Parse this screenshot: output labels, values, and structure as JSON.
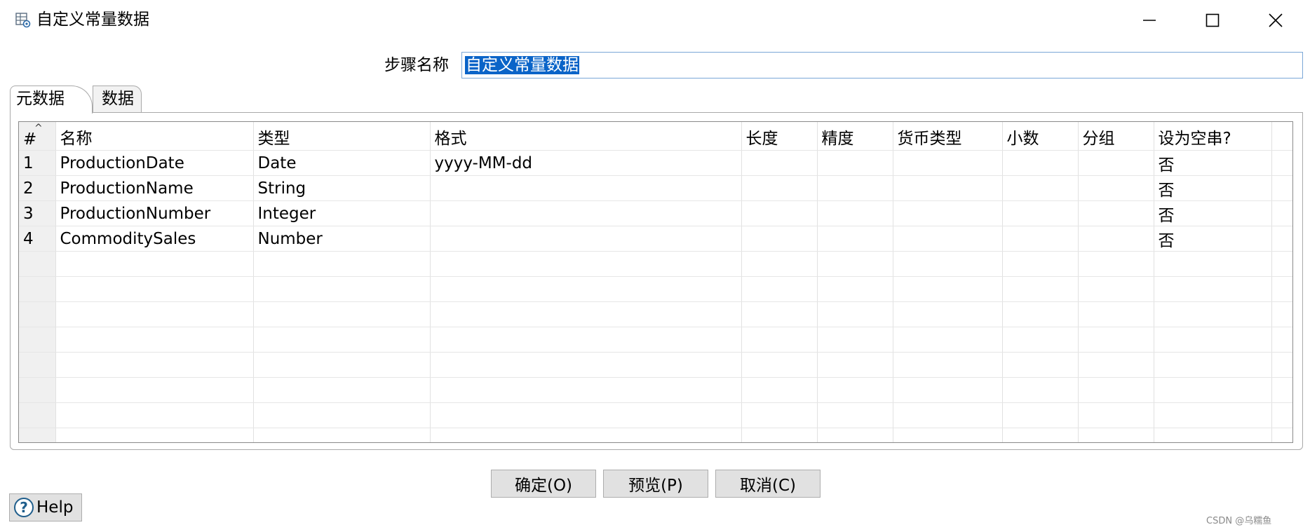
{
  "window": {
    "title": "自定义常量数据",
    "icon": "table-gear-icon",
    "controls": [
      "minimize-icon",
      "maximize-icon",
      "close-icon"
    ]
  },
  "step": {
    "label": "步骤名称",
    "value": "自定义常量数据"
  },
  "tabs": [
    {
      "label": "元数据",
      "active": true
    },
    {
      "label": "数据",
      "active": false
    }
  ],
  "grid": {
    "columns": [
      "#",
      "名称",
      "类型",
      "格式",
      "长度",
      "精度",
      "货币类型",
      "小数",
      "分组",
      "设为空串?"
    ],
    "rows": [
      [
        "1",
        "ProductionDate",
        "Date",
        "yyyy-MM-dd",
        "",
        "",
        "",
        "",
        "",
        "否"
      ],
      [
        "2",
        "ProductionName",
        "String",
        "",
        "",
        "",
        "",
        "",
        "",
        "否"
      ],
      [
        "3",
        "ProductionNumber",
        "Integer",
        "",
        "",
        "",
        "",
        "",
        "",
        "否"
      ],
      [
        "4",
        "CommoditySales",
        "Number",
        "",
        "",
        "",
        "",
        "",
        "",
        "否"
      ]
    ]
  },
  "buttons": {
    "ok": "确定(O)",
    "preview": "预览(P)",
    "cancel": "取消(C)",
    "help": "Help"
  },
  "watermark": "CSDN @乌糯鱼"
}
